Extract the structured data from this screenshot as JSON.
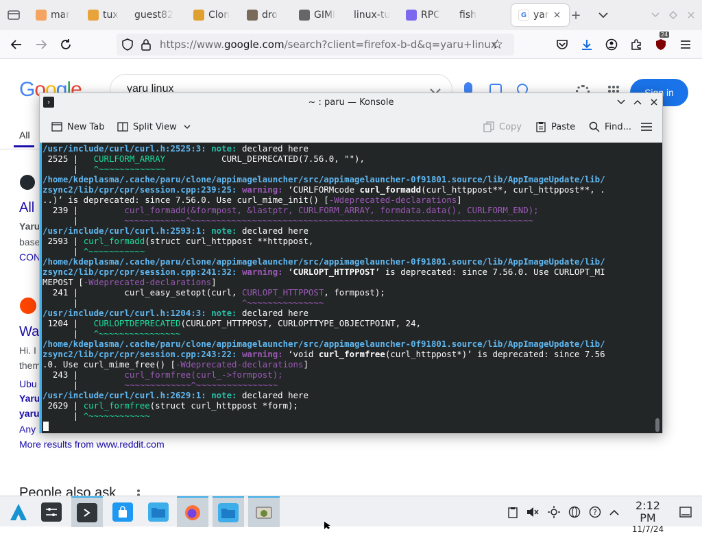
{
  "browser": {
    "tabs": [
      {
        "label": "mar",
        "color": "#f4a460"
      },
      {
        "label": "tux",
        "color": "#e8a33b"
      },
      {
        "label": "guest82",
        "color": ""
      },
      {
        "label": "Clon",
        "color": "#e0a030"
      },
      {
        "label": "dro",
        "color": "#7a6a5a"
      },
      {
        "label": "GIMI",
        "color": "#666666"
      },
      {
        "label": "linux-tu",
        "color": ""
      },
      {
        "label": "RPC",
        "color": "#7b68ee"
      },
      {
        "label": "fish",
        "color": ""
      }
    ],
    "active_tab": {
      "label": "yar",
      "close": "×"
    },
    "new_tab": "+",
    "url_prefix": "https://www.",
    "url_host": "google.com",
    "url_path": "/search?client=firefox-b-d&q=yaru+linux",
    "badge_count": "24"
  },
  "google": {
    "logo": "Google",
    "query": "yaru linux",
    "signin": "Sign in",
    "all_tab": "All",
    "fragments": {
      "all": "All",
      "yaru": "Yaru",
      "base": "base",
      "con": "CON",
      "wa": "Wa",
      "hi": "Hi. I",
      "them": "them",
      "ubu": "Ubu",
      "yaru2": "Yaru",
      "yaru3": "yaru",
      "any": "Any",
      "more": "More results from www.reddit.com",
      "paa": "People also ask"
    }
  },
  "konsole": {
    "title": "~ : paru — Konsole",
    "toolbar": {
      "new_tab": "New Tab",
      "split_view": "Split View",
      "copy": "Copy",
      "paste": "Paste",
      "find": "Find..."
    },
    "lines": [
      [
        [
          "/usr/include/curl/curl.h:2525:3: ",
          "path"
        ],
        [
          "note:",
          "note"
        ],
        [
          " declared here",
          "w"
        ]
      ],
      [
        [
          " 2525 | ",
          "w"
        ],
        [
          "  CURLFORM_ARRAY",
          "grn"
        ],
        [
          "           CURL_DEPRECATED(7.56.0, \"\"),",
          "w"
        ]
      ],
      [
        [
          "      |   ",
          "w"
        ],
        [
          "^~~~~~~~~~~~~~",
          "grn"
        ]
      ],
      [
        [
          "/home/kdeplasma/.cache/paru/clone/appimagelauncher/src/appimagelauncher-0f91801.source/lib/AppImageUpdate/lib/",
          "path"
        ]
      ],
      [
        [
          "zsync2/lib/cpr/cpr/session.cpp:239:25: ",
          "path"
        ],
        [
          "warning:",
          "warn"
        ],
        [
          " ‘CURLFORMcode ",
          "w"
        ],
        [
          "curl_formadd",
          "bold"
        ],
        [
          "(curl_httppost**, curl_httppost**, .",
          "w"
        ]
      ],
      [
        [
          "..)’ is deprecated: since 7.56.0. Use curl_mime_init() [",
          "w"
        ],
        [
          "-Wdeprecated-declarations",
          "warn"
        ],
        [
          "]",
          "w"
        ]
      ],
      [
        [
          "  239 | ",
          "w"
        ],
        [
          "        curl_formadd(&formpost, &lastptr, CURLFORM_ARRAY, formdata.data(), CURLFORM_END);",
          "warn"
        ]
      ],
      [
        [
          "      |         ",
          "w"
        ],
        [
          "~~~~~~~~~~~~^~~~~~~~~~~~~~~~~~~~~~~~~~~~~~~~~~~~~~~~~~~~~~~~~~~~~~~~~~~~~~~~~~~~",
          "warn"
        ]
      ],
      [
        [
          "/usr/include/curl/curl.h:2593:1: ",
          "path"
        ],
        [
          "note:",
          "note"
        ],
        [
          " declared here",
          "w"
        ]
      ],
      [
        [
          " 2593 | ",
          "w"
        ],
        [
          "curl_formadd",
          "grn"
        ],
        [
          "(struct curl_httppost **httppost,",
          "w"
        ]
      ],
      [
        [
          "      | ",
          "w"
        ],
        [
          "^~~~~~~~~~~~",
          "grn"
        ]
      ],
      [
        [
          "/home/kdeplasma/.cache/paru/clone/appimagelauncher/src/appimagelauncher-0f91801.source/lib/AppImageUpdate/lib/",
          "path"
        ]
      ],
      [
        [
          "zsync2/lib/cpr/cpr/session.cpp:241:32: ",
          "path"
        ],
        [
          "warning:",
          "warn"
        ],
        [
          " ‘",
          "w"
        ],
        [
          "CURLOPT_HTTPPOST",
          "bold"
        ],
        [
          "’ is deprecated: since 7.56.0. Use CURLOPT_MI",
          "w"
        ]
      ],
      [
        [
          "MEPOST [",
          "w"
        ],
        [
          "-Wdeprecated-declarations",
          "warn"
        ],
        [
          "]",
          "w"
        ]
      ],
      [
        [
          "  241 | ",
          "w"
        ],
        [
          "        curl_easy_setopt(curl, ",
          "w"
        ],
        [
          "CURLOPT_HTTPPOST",
          "warn"
        ],
        [
          ", formpost);",
          "w"
        ]
      ],
      [
        [
          "      |                                ",
          "w"
        ],
        [
          "^~~~~~~~~~~~~~~~",
          "warn"
        ]
      ],
      [
        [
          "/usr/include/curl/curl.h:1204:3: ",
          "path"
        ],
        [
          "note:",
          "note"
        ],
        [
          " declared here",
          "w"
        ]
      ],
      [
        [
          " 1204 | ",
          "w"
        ],
        [
          "  CURLOPTDEPRECATED",
          "grn"
        ],
        [
          "(CURLOPT_HTTPPOST, CURLOPTTYPE_OBJECTPOINT, 24,",
          "w"
        ]
      ],
      [
        [
          "      |   ",
          "w"
        ],
        [
          "^~~~~~~~~~~~~~~~~",
          "grn"
        ]
      ],
      [
        [
          "/home/kdeplasma/.cache/paru/clone/appimagelauncher/src/appimagelauncher-0f91801.source/lib/AppImageUpdate/lib/",
          "path"
        ]
      ],
      [
        [
          "zsync2/lib/cpr/cpr/session.cpp:243:22: ",
          "path"
        ],
        [
          "warning:",
          "warn"
        ],
        [
          " ‘void ",
          "w"
        ],
        [
          "curl_formfree",
          "bold"
        ],
        [
          "(curl_httppost*)’ is deprecated: since 7.56",
          "w"
        ]
      ],
      [
        [
          ".0. Use curl_mime_free() [",
          "w"
        ],
        [
          "-Wdeprecated-declarations",
          "warn"
        ],
        [
          "]",
          "w"
        ]
      ],
      [
        [
          "  243 | ",
          "w"
        ],
        [
          "        curl_formfree(curl_->formpost);",
          "warn"
        ]
      ],
      [
        [
          "      |         ",
          "w"
        ],
        [
          "~~~~~~~~~~~~~^~~~~~~~~~~~~~~~~",
          "warn"
        ]
      ],
      [
        [
          "/usr/include/curl/curl.h:2629:1: ",
          "path"
        ],
        [
          "note:",
          "note"
        ],
        [
          " declared here",
          "w"
        ]
      ],
      [
        [
          " 2629 | ",
          "w"
        ],
        [
          "curl_formfree",
          "grn"
        ],
        [
          "(struct curl_httppost *form);",
          "w"
        ]
      ],
      [
        [
          "      | ",
          "w"
        ],
        [
          "^~~~~~~~~~~~~",
          "grn"
        ]
      ]
    ],
    "colors": {
      "path": "#5fb7f0",
      "note": "#27c0a8",
      "warn": "#9b59b6",
      "grn": "#1cdc9a",
      "bold": "#fcfcfc",
      "w": "#fcfcfc"
    }
  },
  "taskbar": {
    "clock_time": "2:12 PM",
    "clock_date": "11/7/24"
  }
}
